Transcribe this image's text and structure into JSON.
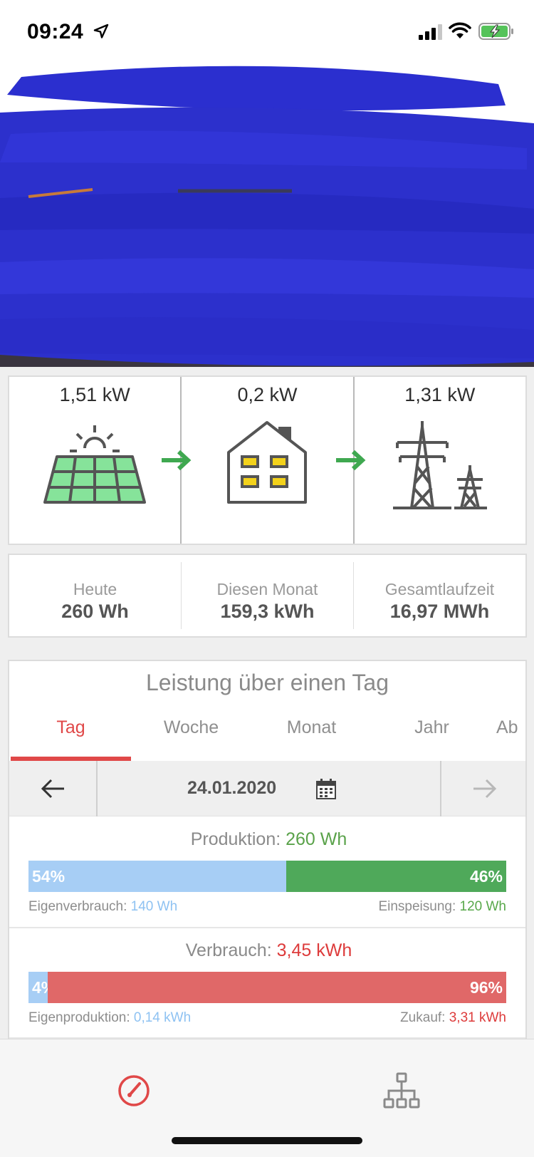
{
  "status": {
    "time": "09:24"
  },
  "flow": {
    "solar": {
      "value": "1,51 kW"
    },
    "house": {
      "value": "0,2 kW"
    },
    "grid": {
      "value": "1,31 kW"
    }
  },
  "stats": [
    {
      "label": "Heute",
      "value": "260 Wh"
    },
    {
      "label": "Diesen Monat",
      "value": "159,3 kWh"
    },
    {
      "label": "Gesamtlaufzeit",
      "value": "16,97 MWh"
    }
  ],
  "chart": {
    "title": "Leistung über einen Tag",
    "tabs": [
      "Tag",
      "Woche",
      "Monat",
      "Jahr",
      "Ab"
    ],
    "active_tab": "Tag",
    "date": "24.01.2020",
    "production": {
      "label": "Produktion:",
      "value": "260 Wh",
      "left_pct": "54%",
      "right_pct": "46%",
      "left_fraction": 0.54,
      "left_label": "Eigenverbrauch:",
      "left_value": "140 Wh",
      "right_label": "Einspeisung:",
      "right_value": "120 Wh"
    },
    "consumption": {
      "label": "Verbrauch:",
      "value": "3,45 kWh",
      "left_pct": "4%",
      "right_pct": "96%",
      "left_fraction": 0.04,
      "left_label": "Eigenproduktion:",
      "left_value": "0,14 kWh",
      "right_label": "Zukauf:",
      "right_value": "3,31 kWh"
    }
  },
  "colors": {
    "accent": "#e04848",
    "self_use": "#a7cef5",
    "feed_in": "#4fa95a",
    "purchase": "#e06868",
    "solar_panel": "#86e39a",
    "window": "#f3d21b",
    "flow_arrow": "#3fa850"
  },
  "icons": {
    "location": "location-arrow-icon",
    "signal": "cellular-signal-icon",
    "wifi": "wifi-icon",
    "battery": "battery-charging-icon",
    "solar": "solar-panel-icon",
    "house": "house-icon",
    "grid": "power-tower-icon",
    "prev": "arrow-left-icon",
    "next": "arrow-right-icon",
    "calendar": "calendar-icon",
    "dashboard": "speedometer-icon",
    "network": "network-hierarchy-icon"
  }
}
